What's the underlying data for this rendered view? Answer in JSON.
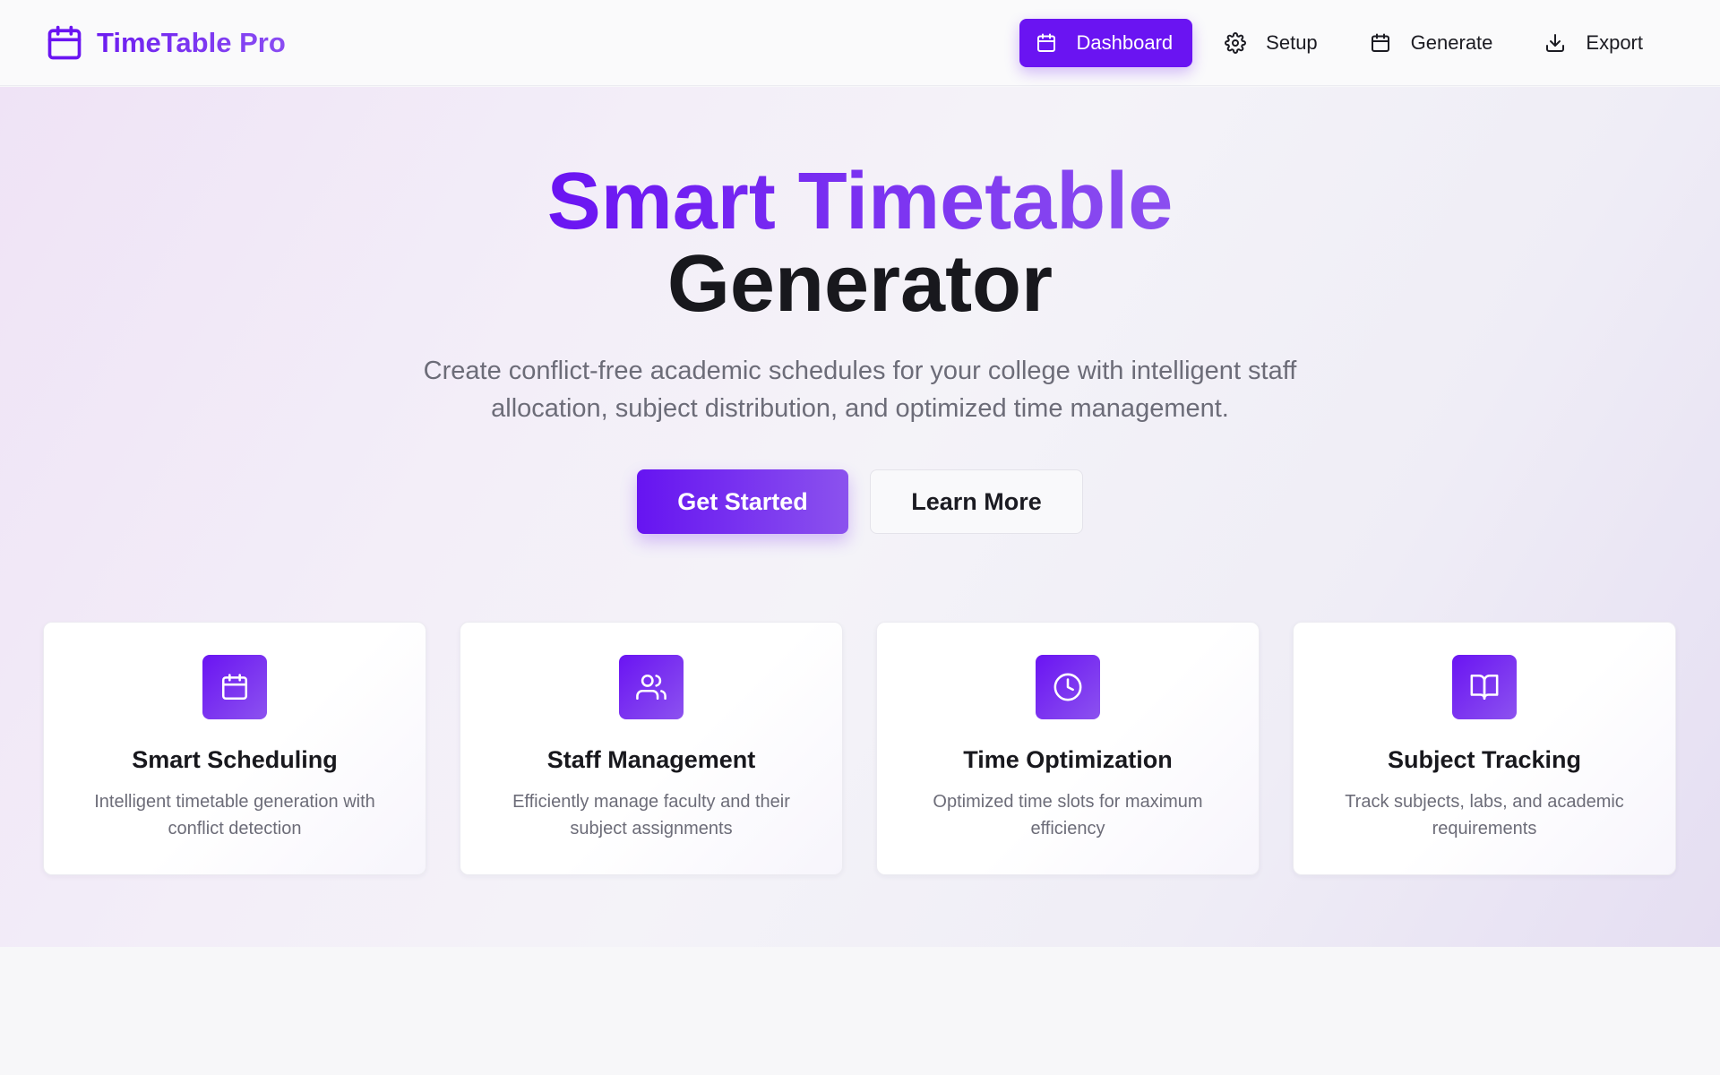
{
  "brand": {
    "name": "TimeTable Pro",
    "icon": "calendar-icon"
  },
  "nav": {
    "items": [
      {
        "label": "Dashboard",
        "icon": "calendar-icon",
        "active": true
      },
      {
        "label": "Setup",
        "icon": "gear-icon",
        "active": false
      },
      {
        "label": "Generate",
        "icon": "calendar-icon",
        "active": false
      },
      {
        "label": "Export",
        "icon": "download-icon",
        "active": false
      }
    ]
  },
  "hero": {
    "title_line1": "Smart Timetable",
    "title_line2": "Generator",
    "subtitle": "Create conflict-free academic schedules for your college with intelligent staff allocation, subject distribution, and optimized time management.",
    "primary_button": "Get Started",
    "secondary_button": "Learn More"
  },
  "features": [
    {
      "icon": "calendar-icon",
      "title": "Smart Scheduling",
      "description": "Intelligent timetable generation with conflict detection"
    },
    {
      "icon": "users-icon",
      "title": "Staff Management",
      "description": "Efficiently manage faculty and their subject assignments"
    },
    {
      "icon": "clock-icon",
      "title": "Time Optimization",
      "description": "Optimized time slots for maximum efficiency"
    },
    {
      "icon": "book-icon",
      "title": "Subject Tracking",
      "description": "Track subjects, labs, and academic requirements"
    }
  ],
  "colors": {
    "accent": "#6a14f2",
    "accent_light": "#8b4ef0",
    "text_dark": "#18181d",
    "text_muted": "#6c6c78"
  }
}
